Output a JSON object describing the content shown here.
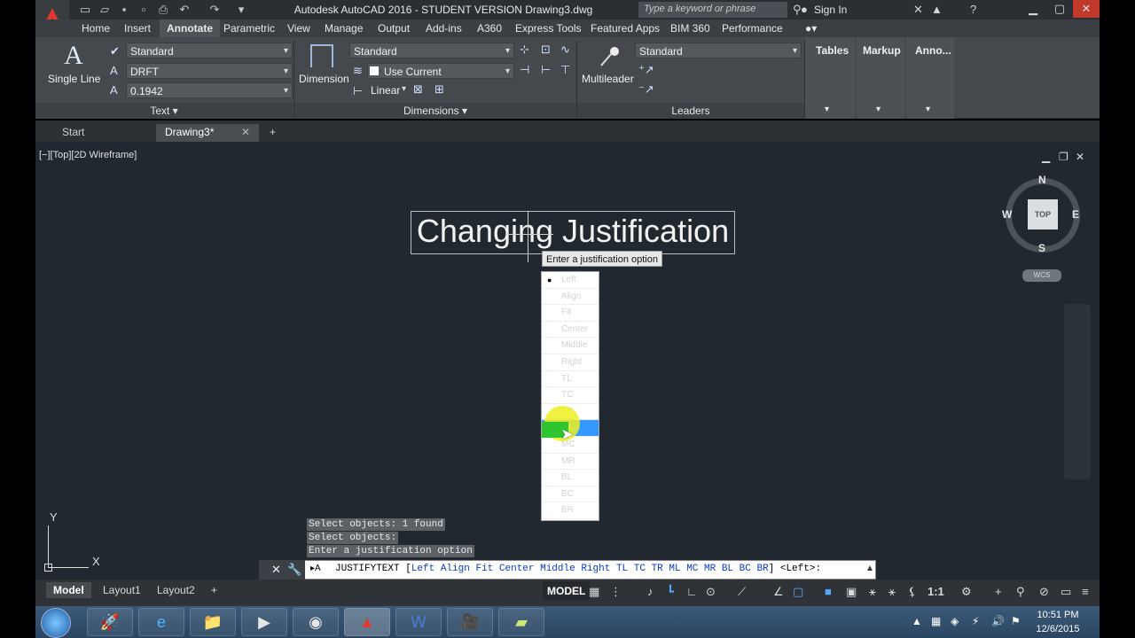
{
  "window": {
    "title": "Autodesk AutoCAD 2016 - STUDENT VERSION   Drawing3.dwg",
    "search_placeholder": "Type a keyword or phrase",
    "sign_in": "Sign In"
  },
  "ribbon_tabs": [
    "Home",
    "Insert",
    "Annotate",
    "Parametric",
    "View",
    "Manage",
    "Output",
    "Add-ins",
    "A360",
    "Express Tools",
    "Featured Apps",
    "BIM 360",
    "Performance"
  ],
  "ribbon": {
    "text_panel": {
      "big_button": "Single Line",
      "style": "Standard",
      "font": "DRFT",
      "height": "0.1942",
      "title": "Text"
    },
    "dimensions_panel": {
      "big_button": "Dimension",
      "style": "Standard",
      "layer": "Use Current",
      "type": "Linear",
      "title": "Dimensions"
    },
    "leaders_panel": {
      "big_button": "Multileader",
      "style": "Standard",
      "title": "Leaders"
    },
    "extra_panels": [
      "Tables",
      "Markup",
      "Anno..."
    ]
  },
  "file_tabs": {
    "start": "Start",
    "active": "Drawing3*",
    "add": "+"
  },
  "viewport": {
    "label": "[−][Top][2D Wireframe]",
    "drawing_text": "Changing Justification",
    "tooltip": "Enter a justification option"
  },
  "justify_menu": {
    "items": [
      "Left",
      "Align",
      "Fit",
      "Center",
      "Middle",
      "Right",
      "TL",
      "TC",
      "TR",
      "ML",
      "MC",
      "MR",
      "BL",
      "BC",
      "BR"
    ],
    "current": "Left",
    "highlighted": "ML"
  },
  "viewcube": {
    "north": "N",
    "south": "S",
    "east": "E",
    "west": "W",
    "face": "TOP",
    "wcs": "WCS"
  },
  "ucs": {
    "x": "X",
    "y": "Y"
  },
  "command": {
    "history": [
      "Select objects: 1 found",
      "Select objects:",
      "Enter a justification option"
    ],
    "prompt_name": "JUSTIFYTEXT",
    "default": "<Left>:"
  },
  "layout_tabs": [
    "Model",
    "Layout1",
    "Layout2"
  ],
  "status": {
    "model": "MODEL",
    "scale": "1:1"
  },
  "taskbar": {
    "time": "10:51 PM",
    "date": "12/6/2015"
  }
}
